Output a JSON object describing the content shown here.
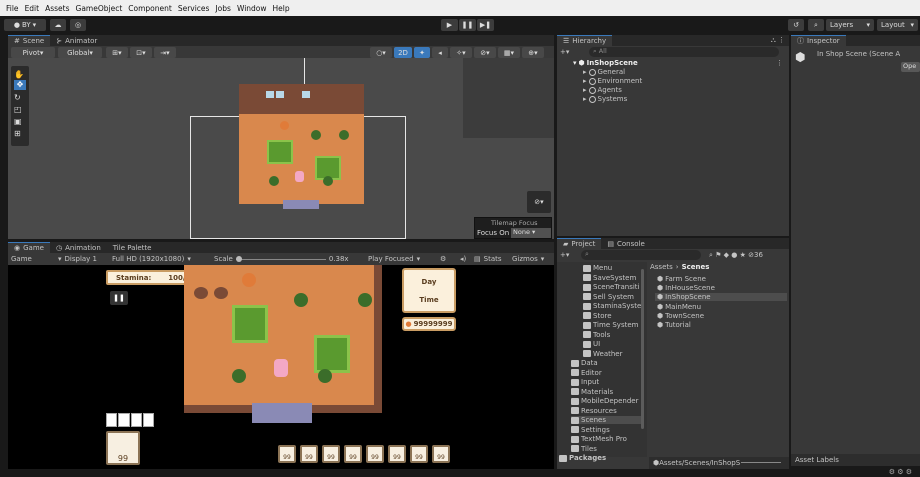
{
  "menu": [
    "File",
    "Edit",
    "Assets",
    "GameObject",
    "Component",
    "Services",
    "Jobs",
    "Window",
    "Help"
  ],
  "toolbar": {
    "account": "BY",
    "layers": "Layers",
    "layout": "Layout"
  },
  "scene_tabs": {
    "scene": "Scene",
    "animator": "Animator"
  },
  "scene_toolbar": {
    "pivot": "Pivot",
    "global": "Global",
    "mode_2d": "2D"
  },
  "tilemap_focus": {
    "title": "Tilemap Focus",
    "label": "Focus On",
    "value": "None"
  },
  "game_tabs": {
    "game": "Game",
    "animation": "Animation",
    "tile_palette": "Tile Palette"
  },
  "game_toolbar": {
    "game": "Game",
    "display": "Display 1",
    "resolution": "Full HD (1920x1080)",
    "scale_label": "Scale",
    "scale_value": "0.38x",
    "play_mode": "Play Focused",
    "stats": "Stats",
    "gizmos": "Gizmos"
  },
  "game_ui": {
    "stamina_label": "Stamina:",
    "stamina_value": "100/100",
    "day": "Day",
    "time": "Time",
    "money": "99999999",
    "big_slot": "99",
    "hotbar": [
      "99",
      "99",
      "99",
      "99",
      "99",
      "99",
      "99",
      "99"
    ]
  },
  "hierarchy": {
    "title": "Hierarchy",
    "search": "All",
    "root": "InShopScene",
    "children": [
      "General",
      "Environment",
      "Agents",
      "Systems"
    ]
  },
  "inspector": {
    "title": "Inspector",
    "object": "In Shop Scene (Scene A",
    "open": "Ope"
  },
  "project": {
    "tab_project": "Project",
    "tab_console": "Console",
    "count": "36",
    "folders": [
      "Menu",
      "SaveSystem",
      "SceneTransiti",
      "Sell System",
      "StaminaSyste",
      "Store",
      "Time System",
      "Tools",
      "UI",
      "Weather",
      "Data",
      "Editor",
      "Input",
      "Materials",
      "MobileDepender",
      "Resources",
      "Scenes",
      "Settings",
      "TextMesh Pro",
      "Tiles",
      "Packages"
    ],
    "breadcrumb": [
      "Assets",
      "Scenes"
    ],
    "files": [
      "Farm Scene",
      "InHouseScene",
      "InShopScene",
      "MainMenu",
      "TownScene",
      "Tutorial"
    ],
    "path": "Assets/Scenes/InShopS",
    "asset_labels": "Asset Labels"
  },
  "colors": {
    "accent": "#3a79bb",
    "floor": "#d9884d",
    "wall": "#7a4a36",
    "rug": "#5a9a2f",
    "selection": "#2c5d87"
  }
}
